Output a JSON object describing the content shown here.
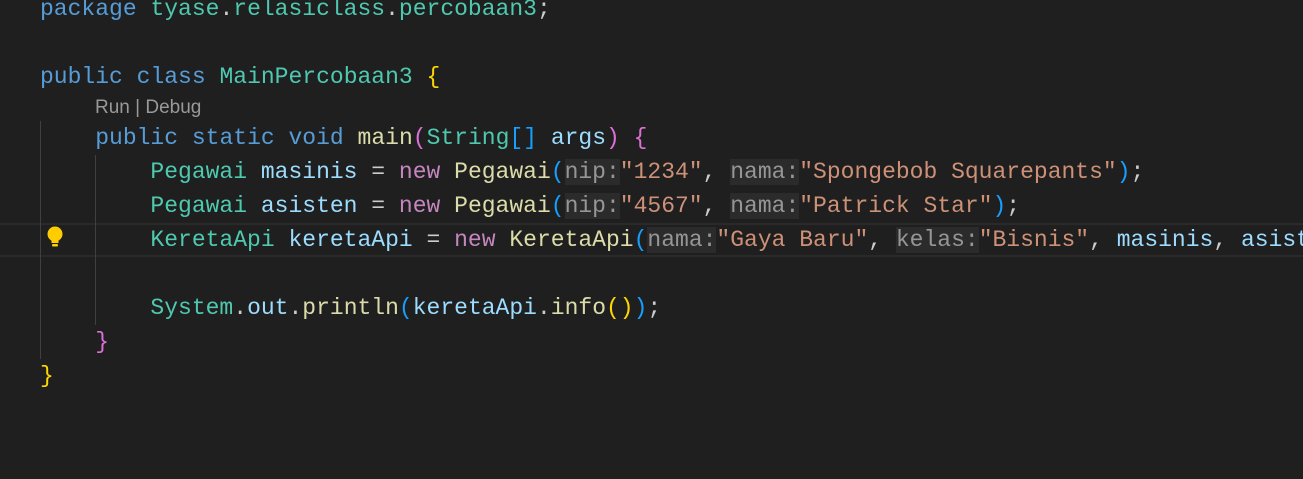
{
  "codelens": {
    "run": "Run",
    "separator": " | ",
    "debug": "Debug"
  },
  "lines": [
    {
      "indent": 0,
      "tokens": [
        [
          "kw",
          "package"
        ],
        [
          "pl",
          " "
        ],
        [
          "ty",
          "tyase"
        ],
        [
          "pl",
          "."
        ],
        [
          "ty",
          "relasiclass"
        ],
        [
          "pl",
          "."
        ],
        [
          "ty",
          "percobaan3"
        ],
        [
          "pl",
          ";"
        ]
      ]
    },
    {
      "indent": 0,
      "tokens": []
    },
    {
      "indent": 0,
      "tokens": [
        [
          "kw",
          "public"
        ],
        [
          "pl",
          " "
        ],
        [
          "kw",
          "class"
        ],
        [
          "pl",
          " "
        ],
        [
          "ty",
          "MainPercobaan3"
        ],
        [
          "pl",
          " "
        ],
        [
          "b1",
          "{"
        ]
      ],
      "codelens_after": true
    },
    {
      "indent": 4,
      "tokens": [
        [
          "kw",
          "public"
        ],
        [
          "pl",
          " "
        ],
        [
          "kw",
          "static"
        ],
        [
          "pl",
          " "
        ],
        [
          "kw",
          "void"
        ],
        [
          "pl",
          " "
        ],
        [
          "fn",
          "main"
        ],
        [
          "b2",
          "("
        ],
        [
          "ty",
          "String"
        ],
        [
          "b3",
          "[]"
        ],
        [
          "pl",
          " "
        ],
        [
          "va",
          "args"
        ],
        [
          "b2",
          ")"
        ],
        [
          "pl",
          " "
        ],
        [
          "b2",
          "{"
        ]
      ]
    },
    {
      "indent": 8,
      "tokens": [
        [
          "ty",
          "Pegawai"
        ],
        [
          "pl",
          " "
        ],
        [
          "va",
          "masinis"
        ],
        [
          "pl",
          " = "
        ],
        [
          "ct",
          "new"
        ],
        [
          "pl",
          " "
        ],
        [
          "fn",
          "Pegawai"
        ],
        [
          "b3",
          "("
        ],
        [
          "hint",
          "nip:"
        ],
        [
          "st",
          "\"1234\""
        ],
        [
          "pl",
          ", "
        ],
        [
          "hint",
          "nama:"
        ],
        [
          "st",
          "\"Spongebob Squarepants\""
        ],
        [
          "b3",
          ")"
        ],
        [
          "pl",
          ";"
        ]
      ]
    },
    {
      "indent": 8,
      "tokens": [
        [
          "ty",
          "Pegawai"
        ],
        [
          "pl",
          " "
        ],
        [
          "va",
          "asisten"
        ],
        [
          "pl",
          " = "
        ],
        [
          "ct",
          "new"
        ],
        [
          "pl",
          " "
        ],
        [
          "fn",
          "Pegawai"
        ],
        [
          "b3",
          "("
        ],
        [
          "hint",
          "nip:"
        ],
        [
          "st",
          "\"4567\""
        ],
        [
          "pl",
          ", "
        ],
        [
          "hint",
          "nama:"
        ],
        [
          "st",
          "\"Patrick Star\""
        ],
        [
          "b3",
          ")"
        ],
        [
          "pl",
          ";"
        ]
      ]
    },
    {
      "indent": 8,
      "current": true,
      "tokens": [
        [
          "ty",
          "KeretaApi"
        ],
        [
          "pl",
          " "
        ],
        [
          "va",
          "keretaApi"
        ],
        [
          "pl",
          " = "
        ],
        [
          "ct",
          "new"
        ],
        [
          "pl",
          " "
        ],
        [
          "fn",
          "KeretaApi"
        ],
        [
          "b3",
          "("
        ],
        [
          "hint",
          "nama:"
        ],
        [
          "st",
          "\"Gaya Baru\""
        ],
        [
          "pl",
          ", "
        ],
        [
          "hint",
          "kelas:"
        ],
        [
          "st",
          "\"Bisnis\""
        ],
        [
          "pl",
          ", "
        ],
        [
          "va",
          "masinis"
        ],
        [
          "pl",
          ", "
        ],
        [
          "va",
          "asisten"
        ],
        [
          "b3",
          ")"
        ],
        [
          "pl",
          ";"
        ]
      ]
    },
    {
      "indent": 0,
      "tokens": []
    },
    {
      "indent": 8,
      "tokens": [
        [
          "ty",
          "System"
        ],
        [
          "pl",
          "."
        ],
        [
          "va",
          "out"
        ],
        [
          "pl",
          "."
        ],
        [
          "fn",
          "println"
        ],
        [
          "b3",
          "("
        ],
        [
          "va",
          "keretaApi"
        ],
        [
          "pl",
          "."
        ],
        [
          "fn",
          "info"
        ],
        [
          "b1",
          "()"
        ],
        [
          "b3",
          ")"
        ],
        [
          "pl",
          ";"
        ]
      ]
    },
    {
      "indent": 4,
      "tokens": [
        [
          "b2",
          "}"
        ]
      ]
    },
    {
      "indent": 0,
      "tokens": [
        [
          "b1",
          "}"
        ]
      ]
    }
  ],
  "colors": {
    "background": "#1f1f1f",
    "lightbulb": "#ffcc00"
  }
}
